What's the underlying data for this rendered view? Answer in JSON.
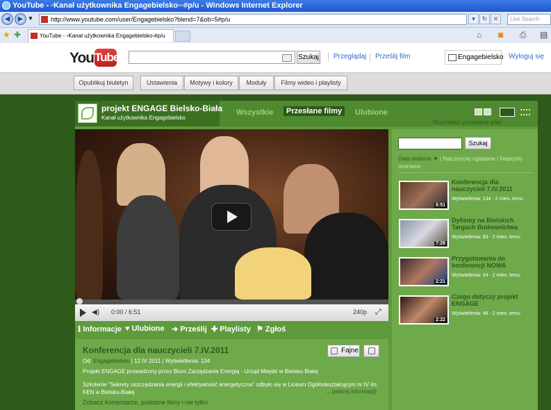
{
  "window": {
    "title": "YouTube - ▫Kanał użytkownika Engagebielsko▫▫#p/u - Windows Internet Explorer"
  },
  "browser": {
    "url": "http://www.youtube.com/user/Engagebielsko?blend=7&ob=5#p/u",
    "search_placeholder": "Live Search",
    "tab_title": "YouTube - ▫Kanał użytkownika Engagebielsko▫#p/u"
  },
  "yt": {
    "logo_you": "You",
    "logo_tube": "Tube",
    "search_button": "Szukaj",
    "nav": [
      "Przeglądaj",
      "Prześlij film"
    ],
    "username": "Engagebielsko",
    "logout": "Wyloguj się"
  },
  "editbar": [
    "Opublikuj biuletyn",
    "Ustawienia",
    "Motywy i kolory",
    "Moduły",
    "Filmy wideo i playlisty"
  ],
  "channel": {
    "title": "projekt ENGAGE Bielsko-Biała",
    "subtitle": "Kanał użytkownika Engagebielsko",
    "tabs": [
      "Wszystkie",
      "Przesłane filmy",
      "Ulubione"
    ],
    "arrange_link": "Rozmieść przesłane pliki"
  },
  "player": {
    "time": "0:00 / 6:51",
    "quality": "240p"
  },
  "player_tabs": [
    "Informacje",
    "Ulubione",
    "Prześlij",
    "Playlisty",
    "Zgłoś"
  ],
  "video": {
    "title": "Konferencja dla nauczycieli 7.IV.2011",
    "meta_prefix": "Od:",
    "meta_user": "Engagebielsko",
    "meta_rest": "| 12 IV 2011 | Wyświetlenia: 134",
    "desc1": "Projekt ENGAGE prowadzony przez Biuro Zarządzania Energią - Urząd Miejski w Bielsku-Białej",
    "desc2": "Szkolenie \"Sekrety oszczędzania energii i efektywność energetyczna\" odbyło się w Liceum Ogólnokształcącym nr IV im. KEN w Bielsku-Białej",
    "more": "... (więcej informacji)",
    "comments": "Zobacz komentarze, podobne filmy i nie tylko",
    "like": "Fajne"
  },
  "side": {
    "search_button": "Szukaj",
    "sort_current": "Data dodania",
    "sort_options": [
      "Najczęściej oglądane",
      "Najwyżej oceniane"
    ],
    "items": [
      {
        "title": "Konferencja dla nauczycieli 7.IV.2011",
        "meta": "Wyświetlenia: 134 - 2 mies. temu",
        "duration": "6:51"
      },
      {
        "title": "Dylismy na Bielskich Targach Budownictwa",
        "meta": "Wyświetlenia: 83 - 2 mies. temu",
        "duration": "7:26"
      },
      {
        "title": "Przygotowania do konferencji NOWA",
        "meta": "Wyświetlenia: 34 - 2 mies. temu",
        "duration": "2:21"
      },
      {
        "title": "Czego dotyczy projekt ENGAGE",
        "meta": "Wyświetlenia: 48 - 2 mies. temu",
        "duration": "2:22"
      }
    ]
  }
}
